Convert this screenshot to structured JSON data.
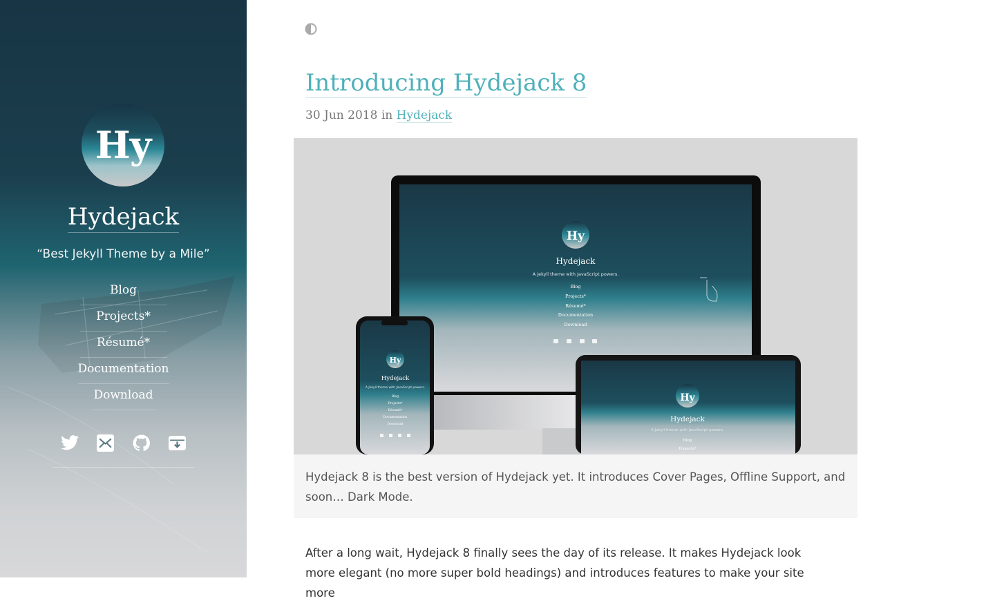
{
  "sidebar": {
    "logo_text": "Hy",
    "site_title": "Hydejack",
    "tagline": "“Best Jekyll Theme by a Mile”",
    "nav": [
      {
        "label": "Blog"
      },
      {
        "label": "Projects*"
      },
      {
        "label": "Résumé*"
      },
      {
        "label": "Documentation"
      },
      {
        "label": "Download"
      }
    ],
    "social_icons": [
      "twitter-icon",
      "email-icon",
      "github-icon",
      "download-icon"
    ]
  },
  "main": {
    "theme_toggle_icon": "contrast-icon",
    "post_title": "Introducing Hydejack 8",
    "post_date": "30 Jun 2018",
    "post_in": "in",
    "post_category": "Hydejack",
    "hero_mockup": {
      "logo_text": "Hy",
      "site_title": "Hydejack",
      "tagline": "A Jekyll theme with JavaScript powers.",
      "nav": [
        "Blog",
        "Projects*",
        "Résumé*",
        "Documentation",
        "Download"
      ]
    },
    "caption": "Hydejack 8 is the best version of Hydejack yet. It introduces Cover Pages, Offline Support, and soon… Dark Mode.",
    "body": "After a long wait, Hydejack 8 finally sees the day of its release. It makes Hydejack look more elegant (no more super bold headings) and introduces features to make your site more"
  },
  "colors": {
    "accent": "#4fb1ba",
    "sidebar_dark": "#173544",
    "caption_bg": "#f5f5f5"
  }
}
